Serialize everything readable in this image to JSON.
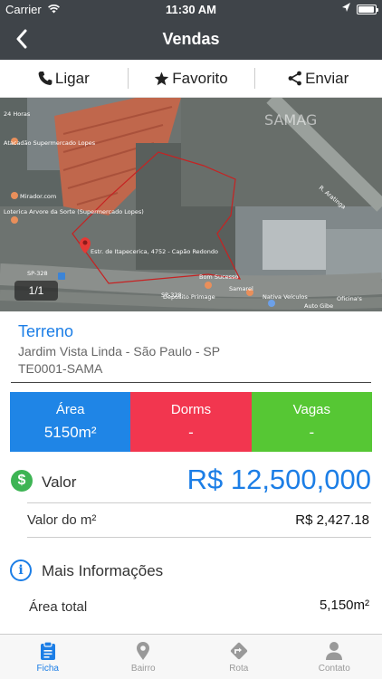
{
  "status_bar": {
    "carrier": "Carrier",
    "time": "11:30 AM"
  },
  "nav": {
    "title": "Vendas"
  },
  "actions": [
    {
      "label": "Ligar",
      "icon": "phone-icon"
    },
    {
      "label": "Favorito",
      "icon": "star-icon"
    },
    {
      "label": "Enviar",
      "icon": "share-icon"
    }
  ],
  "map": {
    "counter": "1/1",
    "watermark": "SAMAG",
    "labels": {
      "l1": "24 Horas",
      "l2": "Atacadão Supermercado Lopes",
      "l3": "Mirador.com",
      "l4": "Loterica Arvore da Sorte (Supermercado Lopes)",
      "l5": "Estr. de Itapecerica, 4752 - Capão Redondo",
      "l6": "Bom Sucesso",
      "l7": "Samarel",
      "l8": "Depósito Primage",
      "l9": "Nativa Veículos",
      "l10": "Auto Gibe",
      "l11": "Oficina's",
      "l12": "R. Aratinga",
      "l13": "SP-328",
      "l14": "SP-328"
    }
  },
  "property": {
    "type": "Terreno",
    "location": "Jardim Vista Linda - São Paulo - SP",
    "code": "TE0001-SAMA"
  },
  "tiles": {
    "area": {
      "label": "Área",
      "value": "5150m²"
    },
    "dorms": {
      "label": "Dorms",
      "value": "-"
    },
    "vagas": {
      "label": "Vagas",
      "value": "-"
    }
  },
  "valor": {
    "label": "Valor",
    "price": "R$ 12,500,000",
    "icon_glyph": "$"
  },
  "valor_m2": {
    "label": "Valor do m²",
    "value": "R$ 2,427.18"
  },
  "mais_info": {
    "label": "Mais Informações",
    "icon_glyph": "i"
  },
  "area_total": {
    "label": "Área total",
    "value": "5,150m²"
  },
  "tabs": [
    {
      "label": "Ficha",
      "icon": "clipboard-icon",
      "active": true
    },
    {
      "label": "Bairro",
      "icon": "map-pin-icon",
      "active": false
    },
    {
      "label": "Rota",
      "icon": "route-icon",
      "active": false
    },
    {
      "label": "Contato",
      "icon": "person-icon",
      "active": false
    }
  ],
  "colors": {
    "header_bg": "#3f4449",
    "accent_blue": "#1c7ee6",
    "tile_area": "#1f85e6",
    "tile_dorms": "#f2364f",
    "tile_vagas": "#56c734",
    "dollar_green": "#3db454"
  }
}
